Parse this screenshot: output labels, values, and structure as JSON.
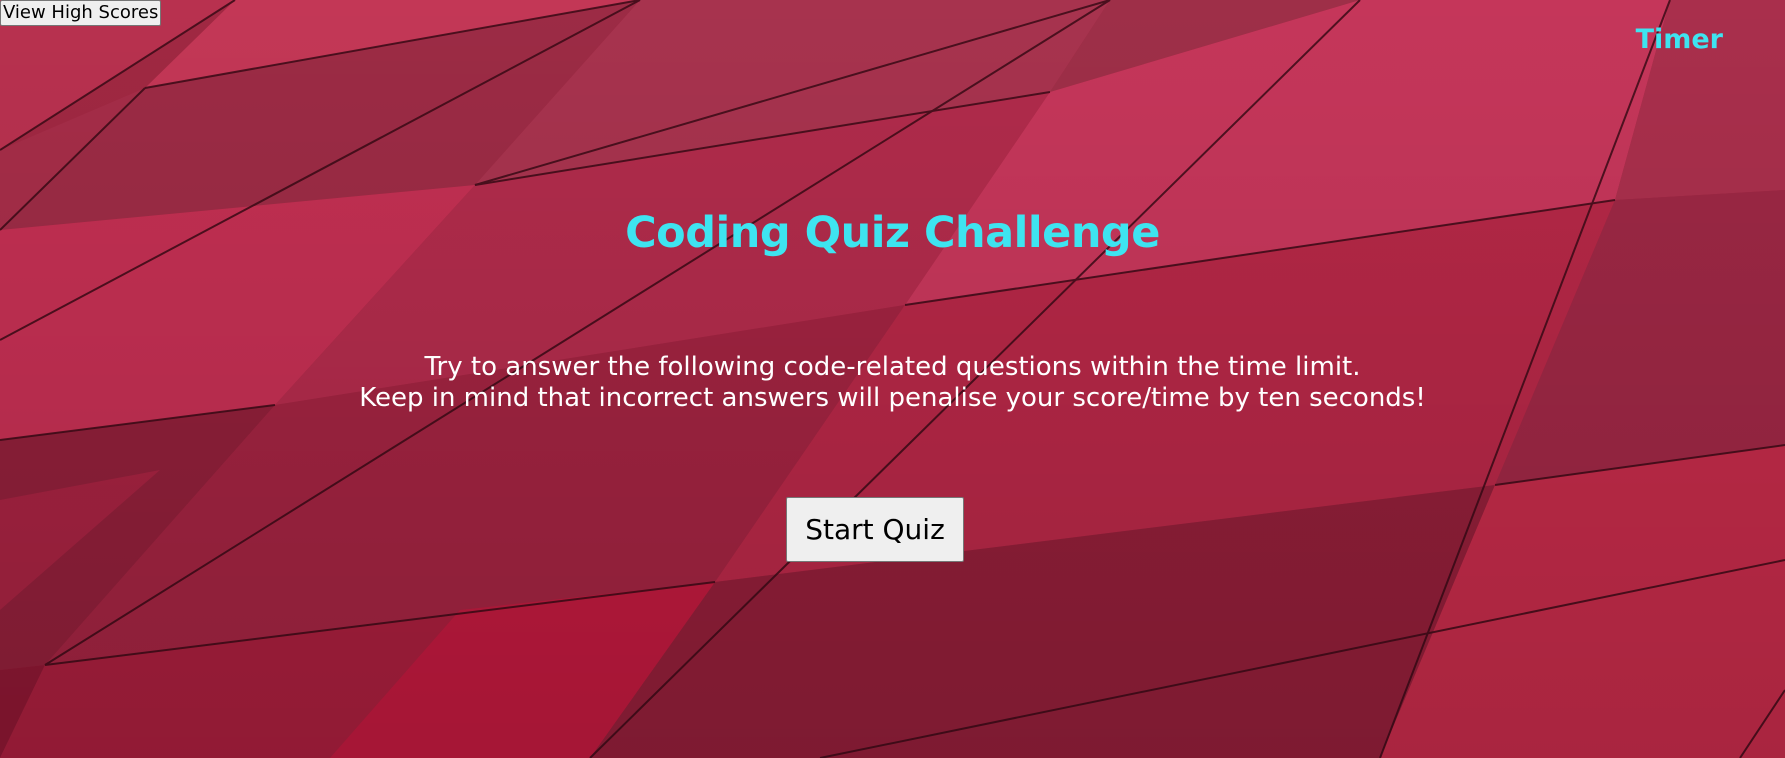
{
  "header": {
    "high_scores_label": "View High Scores",
    "timer_label": "Timer"
  },
  "main": {
    "title": "Coding Quiz Challenge",
    "intro_line_1": "Try to answer the following code-related questions within the time limit.",
    "intro_line_2": "Keep in mind that incorrect answers will penalise your score/time by ten seconds!",
    "start_label": "Start Quiz"
  },
  "colors": {
    "accent": "#3ee4f0",
    "text": "#ffffff",
    "background": "#a3243f"
  }
}
